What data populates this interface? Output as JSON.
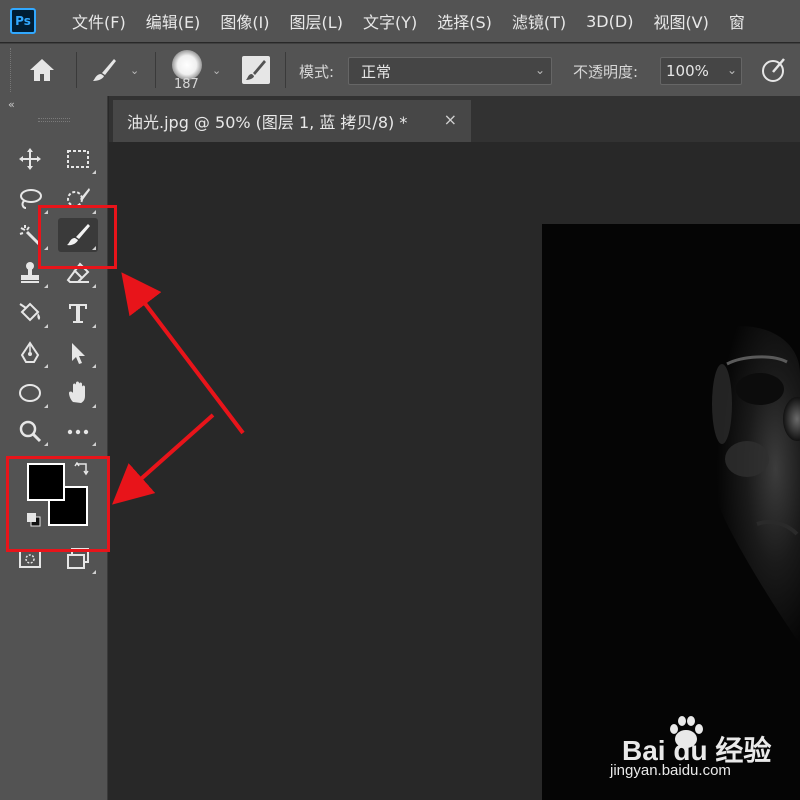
{
  "app": {
    "logo": "Ps"
  },
  "menu": [
    "文件(F)",
    "编辑(E)",
    "图像(I)",
    "图层(L)",
    "文字(Y)",
    "选择(S)",
    "滤镜(T)",
    "3D(D)",
    "视图(V)",
    "窗"
  ],
  "options": {
    "brush_size": "187",
    "mode_label": "模式:",
    "mode_value": "正常",
    "opacity_label": "不透明度:",
    "opacity_value": "100%"
  },
  "tools_panel": {
    "collapse_glyph": "‹‹",
    "tools": [
      {
        "name": "move-tool-icon",
        "col": 0,
        "row": 0
      },
      {
        "name": "marquee-tool-icon",
        "col": 1,
        "row": 0
      },
      {
        "name": "lasso-tool-icon",
        "col": 0,
        "row": 1
      },
      {
        "name": "quick-selection-tool-icon",
        "col": 1,
        "row": 1
      },
      {
        "name": "magic-wand-tool-icon",
        "col": 0,
        "row": 2
      },
      {
        "name": "brush-tool-icon",
        "col": 1,
        "row": 2,
        "active": true
      },
      {
        "name": "clone-stamp-tool-icon",
        "col": 0,
        "row": 3
      },
      {
        "name": "eraser-tool-icon",
        "col": 1,
        "row": 3
      },
      {
        "name": "paint-bucket-tool-icon",
        "col": 0,
        "row": 4
      },
      {
        "name": "type-tool-icon",
        "col": 1,
        "row": 4
      },
      {
        "name": "pen-tool-icon",
        "col": 0,
        "row": 5
      },
      {
        "name": "path-selection-tool-icon",
        "col": 1,
        "row": 5
      },
      {
        "name": "ellipse-tool-icon",
        "col": 0,
        "row": 6
      },
      {
        "name": "hand-tool-icon",
        "col": 1,
        "row": 6
      },
      {
        "name": "zoom-tool-icon",
        "col": 0,
        "row": 7
      },
      {
        "name": "more-tools-icon",
        "col": 1,
        "row": 7
      }
    ],
    "foreground_color": "#000000",
    "background_color": "#000000"
  },
  "document": {
    "tab_title": "油光.jpg @ 50% (图层 1, 蓝 拷贝/8) *",
    "close_glyph": "×"
  },
  "annotation_color": "#e8141a",
  "watermark": {
    "brand": "Bai du 经验",
    "url": "jingyan.baidu.com"
  }
}
